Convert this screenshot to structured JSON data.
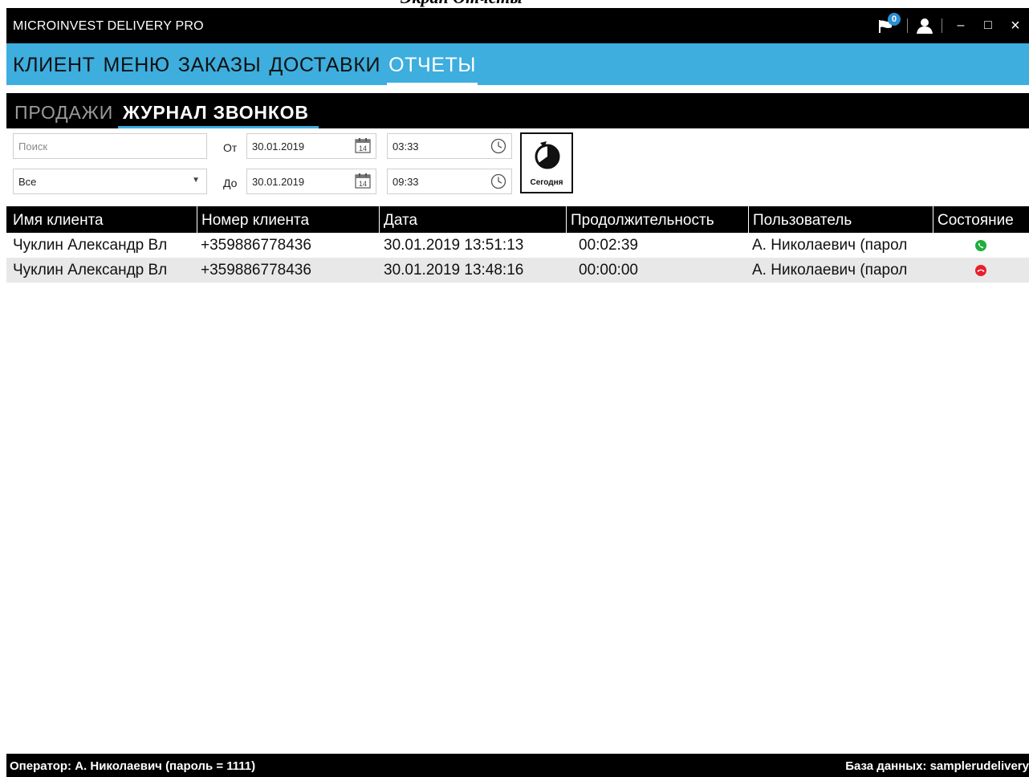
{
  "document": {
    "caption": "Экран Отчеты"
  },
  "window": {
    "title": "MICROINVEST DELIVERY PRO",
    "notification_count": "0",
    "controls": {
      "minimize": "–",
      "maximize": "□",
      "close": "×"
    }
  },
  "main_menu": {
    "items": [
      {
        "label": "КЛИЕНТ"
      },
      {
        "label": "МЕНЮ"
      },
      {
        "label": "ЗАКАЗЫ"
      },
      {
        "label": "ДОСТАВКИ"
      },
      {
        "label": "ОТЧЕТЫ"
      }
    ],
    "active": "ОТЧЕТЫ"
  },
  "sub_menu": {
    "items": [
      {
        "label": "ПРОДАЖИ"
      },
      {
        "label": "ЖУРНАЛ ЗВОНКОВ"
      }
    ],
    "active": "ЖУРНАЛ ЗВОНКОВ"
  },
  "filters": {
    "search": {
      "placeholder": "Поиск",
      "value": ""
    },
    "scope": {
      "selected": "Все"
    },
    "from": {
      "label": "От",
      "date": "30.01.2019",
      "time": "03:33"
    },
    "to": {
      "label": "До",
      "date": "30.01.2019",
      "time": "09:33"
    },
    "calendar_day": "14",
    "today_button": "Сегодня"
  },
  "table": {
    "columns": [
      "Имя клиента",
      "Номер клиента",
      "Дата",
      "Продолжительность",
      "Пользователь",
      "Состояние"
    ],
    "rows": [
      {
        "client": "Чуклин Александр Вл",
        "phone": "+359886778436",
        "date": "30.01.2019 13:51:13",
        "duration": "00:02:39",
        "user": "А. Николаевич (парол",
        "status": "answered-call-icon",
        "status_color": "#1fae3a"
      },
      {
        "client": "Чуклин Александр Вл",
        "phone": "+359886778436",
        "date": "30.01.2019 13:48:16",
        "duration": "00:00:00",
        "user": "А. Николаевич (парол",
        "status": "missed-call-icon",
        "status_color": "#e8202a"
      }
    ]
  },
  "status_bar": {
    "operator": "Оператор: А. Николаевич (пароль = 1111)",
    "database": "База данных: samplerudelivery"
  },
  "colors": {
    "accent": "#3daede",
    "bar": "#000000",
    "row_alt": "#e8e8e8"
  }
}
